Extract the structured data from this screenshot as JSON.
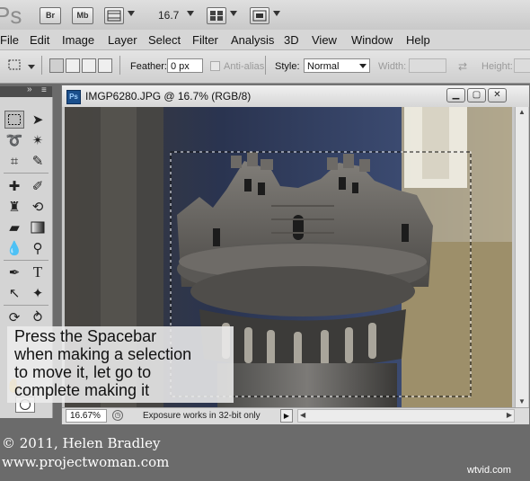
{
  "app": {
    "logo": "Ps",
    "bridge_button": "Br",
    "minibridge_button": "Mb",
    "zoom_level": "16.7"
  },
  "menubar": {
    "items": [
      "File",
      "Edit",
      "Image",
      "Layer",
      "Select",
      "Filter",
      "Analysis",
      "3D",
      "View",
      "Window",
      "Help"
    ]
  },
  "options": {
    "feather_label": "Feather:",
    "feather_value": "0 px",
    "antialias_label": "Anti-alias",
    "style_label": "Style:",
    "style_value": "Normal",
    "width_label": "Width:",
    "height_label": "Height:"
  },
  "document": {
    "ps_badge": "Ps",
    "title": "IMGP6280.JPG @ 16.7% (RGB/8)",
    "zoom_field": "16.67%",
    "status_text": "Exposure works in 32-bit only"
  },
  "tools": {
    "icons": [
      "marquee-icon",
      "move-icon",
      "lasso-icon",
      "magic-wand-icon",
      "crop-icon",
      "eyedropper-icon",
      "healing-brush-icon",
      "brush-icon",
      "clone-stamp-icon",
      "history-brush-icon",
      "eraser-icon",
      "gradient-icon",
      "blur-icon",
      "dodge-icon",
      "pen-icon",
      "type-icon",
      "path-selection-icon",
      "shape-icon",
      "3d-rotate-icon",
      "3d-orbit-icon",
      "hand-icon",
      "zoom-icon"
    ]
  },
  "callout": {
    "line1": "Press the Spacebar",
    "line2": "when making a selection",
    "line3": "to move it, let go to",
    "line4": "complete making it"
  },
  "footer": {
    "copyright": "© 2011, Helen Bradley",
    "website": "www.projectwoman.com",
    "watermark": "wtvid.com"
  },
  "colors": {
    "app_bar": "#d4d4d4",
    "ps_blue": "#1b4f8c",
    "selection": "#222222"
  }
}
